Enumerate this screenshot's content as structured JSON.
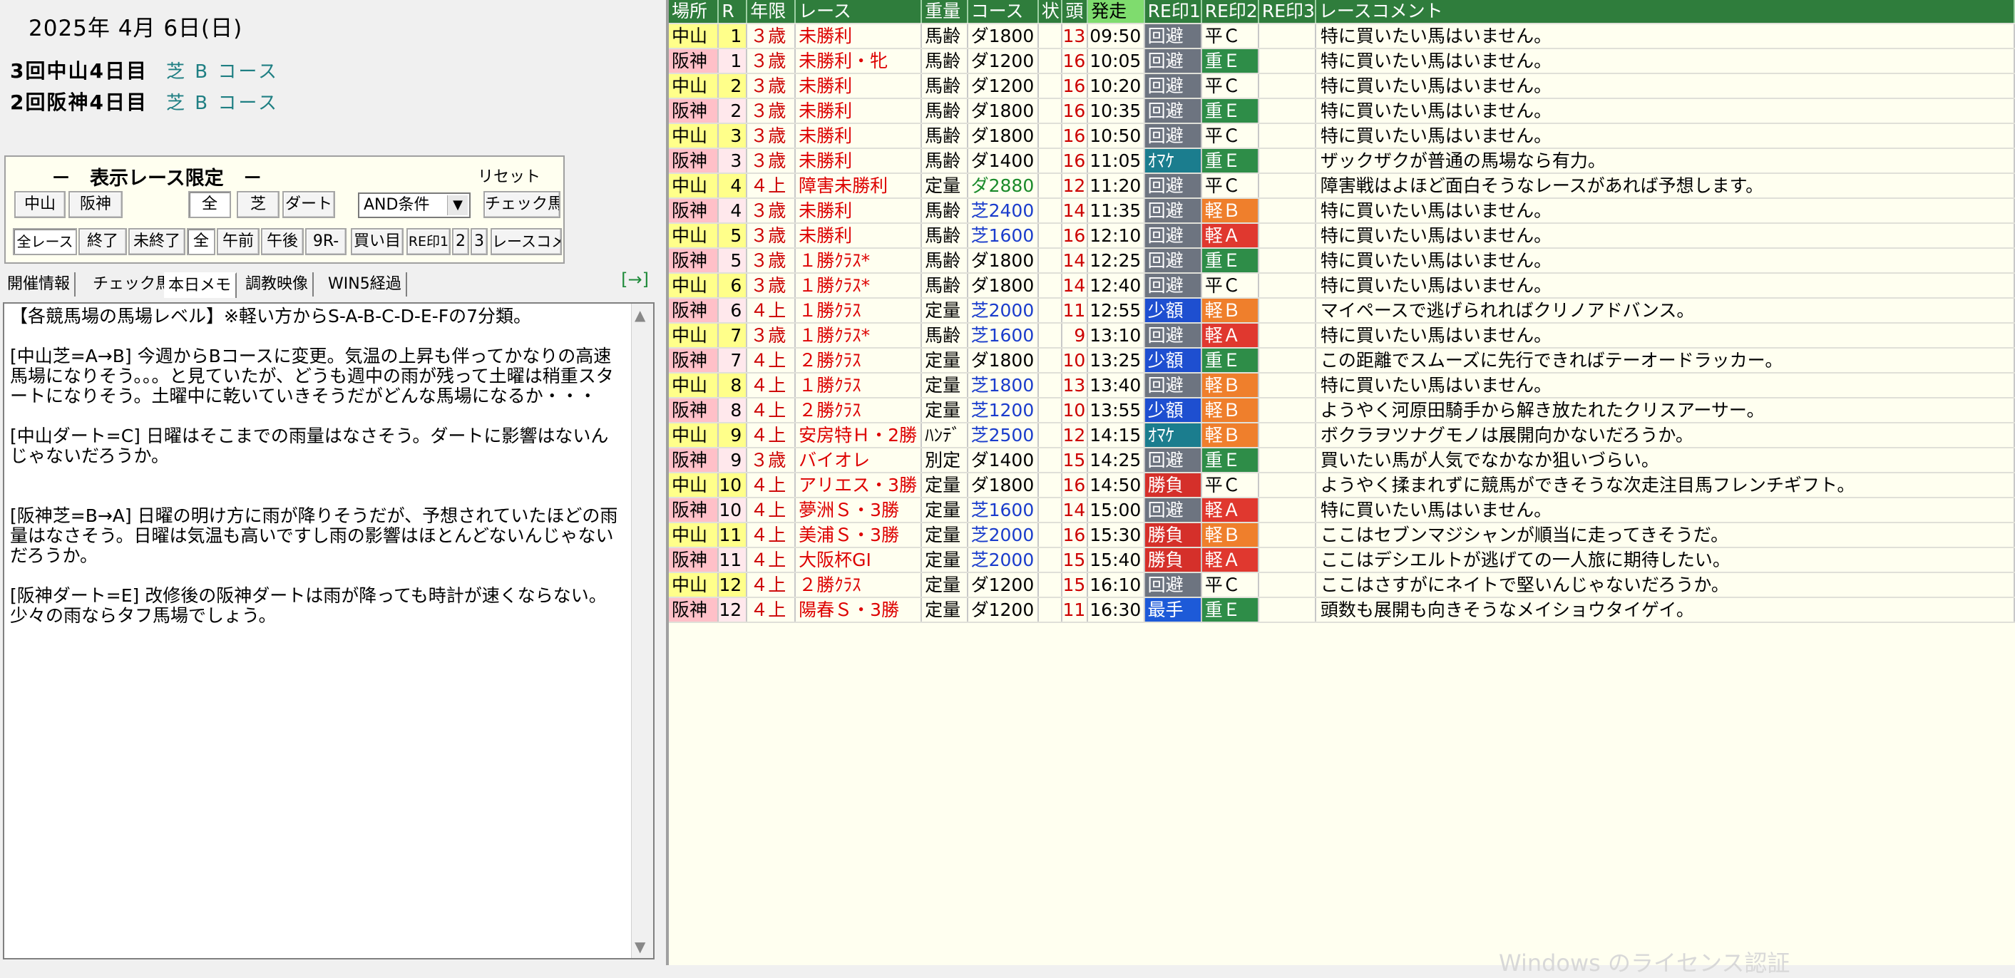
{
  "date": "2025年 4月 6日(日)",
  "venues": [
    {
      "name": "3回中山4日目",
      "course": "芝 B コース"
    },
    {
      "name": "2回阪神4日目",
      "course": "芝 B コース"
    }
  ],
  "filter": {
    "title": "－　表示レース限定　－",
    "reset": "リセット",
    "row1": [
      "中山",
      "阪神",
      "全",
      "芝",
      "ダート"
    ],
    "condition": "AND条件",
    "check_horse": "チェック馬",
    "row2": [
      "全レース",
      "終了",
      "未終了",
      "全",
      "午前",
      "午後",
      "9R-",
      "買い目",
      "RE印1",
      "2",
      "3",
      "レースコメ"
    ]
  },
  "tabs": [
    "開催情報",
    "チェック馬",
    "本日メモ",
    "調教映像",
    "WIN5経過"
  ],
  "tab_arrow": "[→]",
  "memo": "【各競馬場の馬場レベル】※軽い方からS-A-B-C-D-E-Fの7分類。\n\n[中山芝=A→B] 今週からBコースに変更。気温の上昇も伴ってかなりの高速馬場になりそう。。。と見ていたが、どうも週中の雨が残って土曜は稍重スタートになりそう。土曜中に乾いていきそうだがどんな馬場になるか・・・\n\n[中山ダート=C] 日曜はそこまでの雨量はなさそう。ダートに影響はないんじゃないだろうか。\n\n\n[阪神芝=B→A] 日曜の明け方に雨が降りそうだが、予想されていたほどの雨量はなさそう。日曜は気温も高いですし雨の影響はほとんどないんじゃないだろうか。\n\n[阪神ダート=E] 改修後の阪神ダートは雨が降っても時計が速くならない。少々の雨ならタフ馬場でしょう。",
  "columns": [
    "場所",
    "R",
    "年限",
    "レース",
    "重量",
    "コース",
    "状",
    "頭",
    "発走",
    "RE印1",
    "RE印2",
    "RE印3",
    "レースコメント"
  ],
  "races": [
    {
      "place": "中山",
      "r": "1",
      "age": "３歳",
      "race": "未勝利",
      "wt": "馬齢",
      "course": "ダ1800",
      "ctype": "dirt",
      "heads": "13",
      "time": "09:50",
      "t1": "回避",
      "t1c": "kaihi",
      "t2": "平Ｃ",
      "t2c": "hei",
      "cmt": "特に買いたい馬はいません。"
    },
    {
      "place": "阪神",
      "r": "1",
      "age": "３歳",
      "race": "未勝利・牝",
      "wt": "馬齢",
      "course": "ダ1200",
      "ctype": "dirt",
      "heads": "16",
      "time": "10:05",
      "t1": "回避",
      "t1c": "kaihi",
      "t2": "重Ｅ",
      "t2c": "jue",
      "cmt": "特に買いたい馬はいません。"
    },
    {
      "place": "中山",
      "r": "2",
      "age": "３歳",
      "race": "未勝利",
      "wt": "馬齢",
      "course": "ダ1200",
      "ctype": "dirt",
      "heads": "16",
      "time": "10:20",
      "t1": "回避",
      "t1c": "kaihi",
      "t2": "平Ｃ",
      "t2c": "hei",
      "cmt": "特に買いたい馬はいません。"
    },
    {
      "place": "阪神",
      "r": "2",
      "age": "３歳",
      "race": "未勝利",
      "wt": "馬齢",
      "course": "ダ1800",
      "ctype": "dirt",
      "heads": "16",
      "time": "10:35",
      "t1": "回避",
      "t1c": "kaihi",
      "t2": "重Ｅ",
      "t2c": "jue",
      "cmt": "特に買いたい馬はいません。"
    },
    {
      "place": "中山",
      "r": "3",
      "age": "３歳",
      "race": "未勝利",
      "wt": "馬齢",
      "course": "ダ1800",
      "ctype": "dirt",
      "heads": "16",
      "time": "10:50",
      "t1": "回避",
      "t1c": "kaihi",
      "t2": "平Ｃ",
      "t2c": "hei",
      "cmt": "特に買いたい馬はいません。"
    },
    {
      "place": "阪神",
      "r": "3",
      "age": "３歳",
      "race": "未勝利",
      "wt": "馬齢",
      "course": "ダ1400",
      "ctype": "dirt",
      "heads": "16",
      "time": "11:05",
      "t1": "ｵﾏｹ",
      "t1c": "omake",
      "t2": "重Ｅ",
      "t2c": "jue",
      "cmt": "ザックザクが普通の馬場なら有力。"
    },
    {
      "place": "中山",
      "r": "4",
      "age": "４上",
      "race": "障害未勝利",
      "wt": "定量",
      "course": "ダ2880",
      "ctype": "jump",
      "heads": "12",
      "time": "11:20",
      "t1": "回避",
      "t1c": "kaihi",
      "t2": "平Ｃ",
      "t2c": "hei",
      "cmt": "障害戦はよほど面白そうなレースがあれば予想します。"
    },
    {
      "place": "阪神",
      "r": "4",
      "age": "３歳",
      "race": "未勝利",
      "wt": "馬齢",
      "course": "芝2400",
      "ctype": "grass",
      "heads": "14",
      "time": "11:35",
      "t1": "回避",
      "t1c": "kaihi",
      "t2": "軽Ｂ",
      "t2c": "keib",
      "cmt": "特に買いたい馬はいません。"
    },
    {
      "place": "中山",
      "r": "5",
      "age": "３歳",
      "race": "未勝利",
      "wt": "馬齢",
      "course": "芝1600",
      "ctype": "grass",
      "heads": "16",
      "time": "12:10",
      "t1": "回避",
      "t1c": "kaihi",
      "t2": "軽Ａ",
      "t2c": "keia",
      "cmt": "特に買いたい馬はいません。"
    },
    {
      "place": "阪神",
      "r": "5",
      "age": "３歳",
      "race": "１勝ｸﾗｽ*",
      "wt": "馬齢",
      "course": "ダ1800",
      "ctype": "dirt",
      "heads": "14",
      "time": "12:25",
      "t1": "回避",
      "t1c": "kaihi",
      "t2": "重Ｅ",
      "t2c": "jue",
      "cmt": "特に買いたい馬はいません。"
    },
    {
      "place": "中山",
      "r": "6",
      "age": "３歳",
      "race": "１勝ｸﾗｽ*",
      "wt": "馬齢",
      "course": "ダ1800",
      "ctype": "dirt",
      "heads": "14",
      "time": "12:40",
      "t1": "回避",
      "t1c": "kaihi",
      "t2": "平Ｃ",
      "t2c": "hei",
      "cmt": "特に買いたい馬はいません。"
    },
    {
      "place": "阪神",
      "r": "6",
      "age": "４上",
      "race": "１勝ｸﾗｽ",
      "wt": "定量",
      "course": "芝2000",
      "ctype": "grass",
      "heads": "11",
      "time": "12:55",
      "t1": "少額",
      "t1c": "shogaku",
      "t2": "軽Ｂ",
      "t2c": "keib",
      "cmt": "マイペースで逃げられればクリノアドバンス。"
    },
    {
      "place": "中山",
      "r": "7",
      "age": "３歳",
      "race": "１勝ｸﾗｽ*",
      "wt": "馬齢",
      "course": "芝1600",
      "ctype": "grass",
      "heads": "9",
      "time": "13:10",
      "t1": "回避",
      "t1c": "kaihi",
      "t2": "軽Ａ",
      "t2c": "keia",
      "cmt": "特に買いたい馬はいません。"
    },
    {
      "place": "阪神",
      "r": "7",
      "age": "４上",
      "race": "２勝ｸﾗｽ",
      "wt": "定量",
      "course": "ダ1800",
      "ctype": "dirt",
      "heads": "10",
      "time": "13:25",
      "t1": "少額",
      "t1c": "shogaku",
      "t2": "重Ｅ",
      "t2c": "jue",
      "cmt": "この距離でスムーズに先行できればテーオードラッカー。"
    },
    {
      "place": "中山",
      "r": "8",
      "age": "４上",
      "race": "１勝ｸﾗｽ",
      "wt": "定量",
      "course": "芝1800",
      "ctype": "grass",
      "heads": "13",
      "time": "13:40",
      "t1": "回避",
      "t1c": "kaihi",
      "t2": "軽Ｂ",
      "t2c": "keib",
      "cmt": "特に買いたい馬はいません。"
    },
    {
      "place": "阪神",
      "r": "8",
      "age": "４上",
      "race": "２勝ｸﾗｽ",
      "wt": "定量",
      "course": "芝1200",
      "ctype": "grass",
      "heads": "10",
      "time": "13:55",
      "t1": "少額",
      "t1c": "shogaku",
      "t2": "軽Ｂ",
      "t2c": "keib",
      "cmt": "ようやく河原田騎手から解き放たれたクリスアーサー。"
    },
    {
      "place": "中山",
      "r": "9",
      "age": "４上",
      "race": "安房特Ｈ・2勝",
      "wt": "ﾊﾝﾃﾞ",
      "course": "芝2500",
      "ctype": "grass",
      "heads": "12",
      "time": "14:15",
      "t1": "ｵﾏｹ",
      "t1c": "omake",
      "t2": "軽Ｂ",
      "t2c": "keib",
      "cmt": "ボクラヲツナグモノは展開向かないだろうか。"
    },
    {
      "place": "阪神",
      "r": "9",
      "age": "３歳",
      "race": "バイオレ",
      "wt": "別定",
      "course": "ダ1400",
      "ctype": "dirt",
      "heads": "15",
      "time": "14:25",
      "t1": "回避",
      "t1c": "kaihi",
      "t2": "重Ｅ",
      "t2c": "jue",
      "cmt": "買いたい馬が人気でなかなか狙いづらい。"
    },
    {
      "place": "中山",
      "r": "10",
      "age": "４上",
      "race": "アリエス・3勝",
      "wt": "定量",
      "course": "ダ1800",
      "ctype": "dirt",
      "heads": "16",
      "time": "14:50",
      "t1": "勝負",
      "t1c": "shobu",
      "t2": "平Ｃ",
      "t2c": "hei",
      "cmt": "ようやく揉まれずに競馬ができそうな次走注目馬フレンチギフト。"
    },
    {
      "place": "阪神",
      "r": "10",
      "age": "４上",
      "race": "夢洲Ｓ・3勝",
      "wt": "定量",
      "course": "芝1600",
      "ctype": "grass",
      "heads": "14",
      "time": "15:00",
      "t1": "回避",
      "t1c": "kaihi",
      "t2": "軽Ａ",
      "t2c": "keia",
      "cmt": "特に買いたい馬はいません。"
    },
    {
      "place": "中山",
      "r": "11",
      "age": "４上",
      "race": "美浦Ｓ・3勝",
      "wt": "定量",
      "course": "芝2000",
      "ctype": "grass",
      "heads": "16",
      "time": "15:30",
      "t1": "勝負",
      "t1c": "shobu",
      "t2": "軽Ｂ",
      "t2c": "keib",
      "cmt": "ここはセブンマジシャンが順当に走ってきそうだ。"
    },
    {
      "place": "阪神",
      "r": "11",
      "age": "４上",
      "race": "大阪杯GI",
      "wt": "定量",
      "course": "芝2000",
      "ctype": "grass",
      "heads": "15",
      "time": "15:40",
      "t1": "勝負",
      "t1c": "shobu",
      "t2": "軽Ａ",
      "t2c": "keia",
      "cmt": "ここはデシエルトが逃げての一人旅に期待したい。"
    },
    {
      "place": "中山",
      "r": "12",
      "age": "４上",
      "race": "２勝ｸﾗｽ",
      "wt": "定量",
      "course": "ダ1200",
      "ctype": "dirt",
      "heads": "15",
      "time": "16:10",
      "t1": "回避",
      "t1c": "kaihi",
      "t2": "平Ｃ",
      "t2c": "hei",
      "cmt": "ここはさすがにネイトで堅いんじゃないだろうか。"
    },
    {
      "place": "阪神",
      "r": "12",
      "age": "４上",
      "race": "陽春Ｓ・3勝",
      "wt": "定量",
      "course": "ダ1200",
      "ctype": "dirt",
      "heads": "11",
      "time": "16:30",
      "t1": "最手",
      "t1c": "saite",
      "t2": "重Ｅ",
      "t2c": "jue",
      "cmt": "頭数も展開も向きそうなメイショウタイゲイ。"
    }
  ],
  "watermark": "Windows のライセンス認証"
}
